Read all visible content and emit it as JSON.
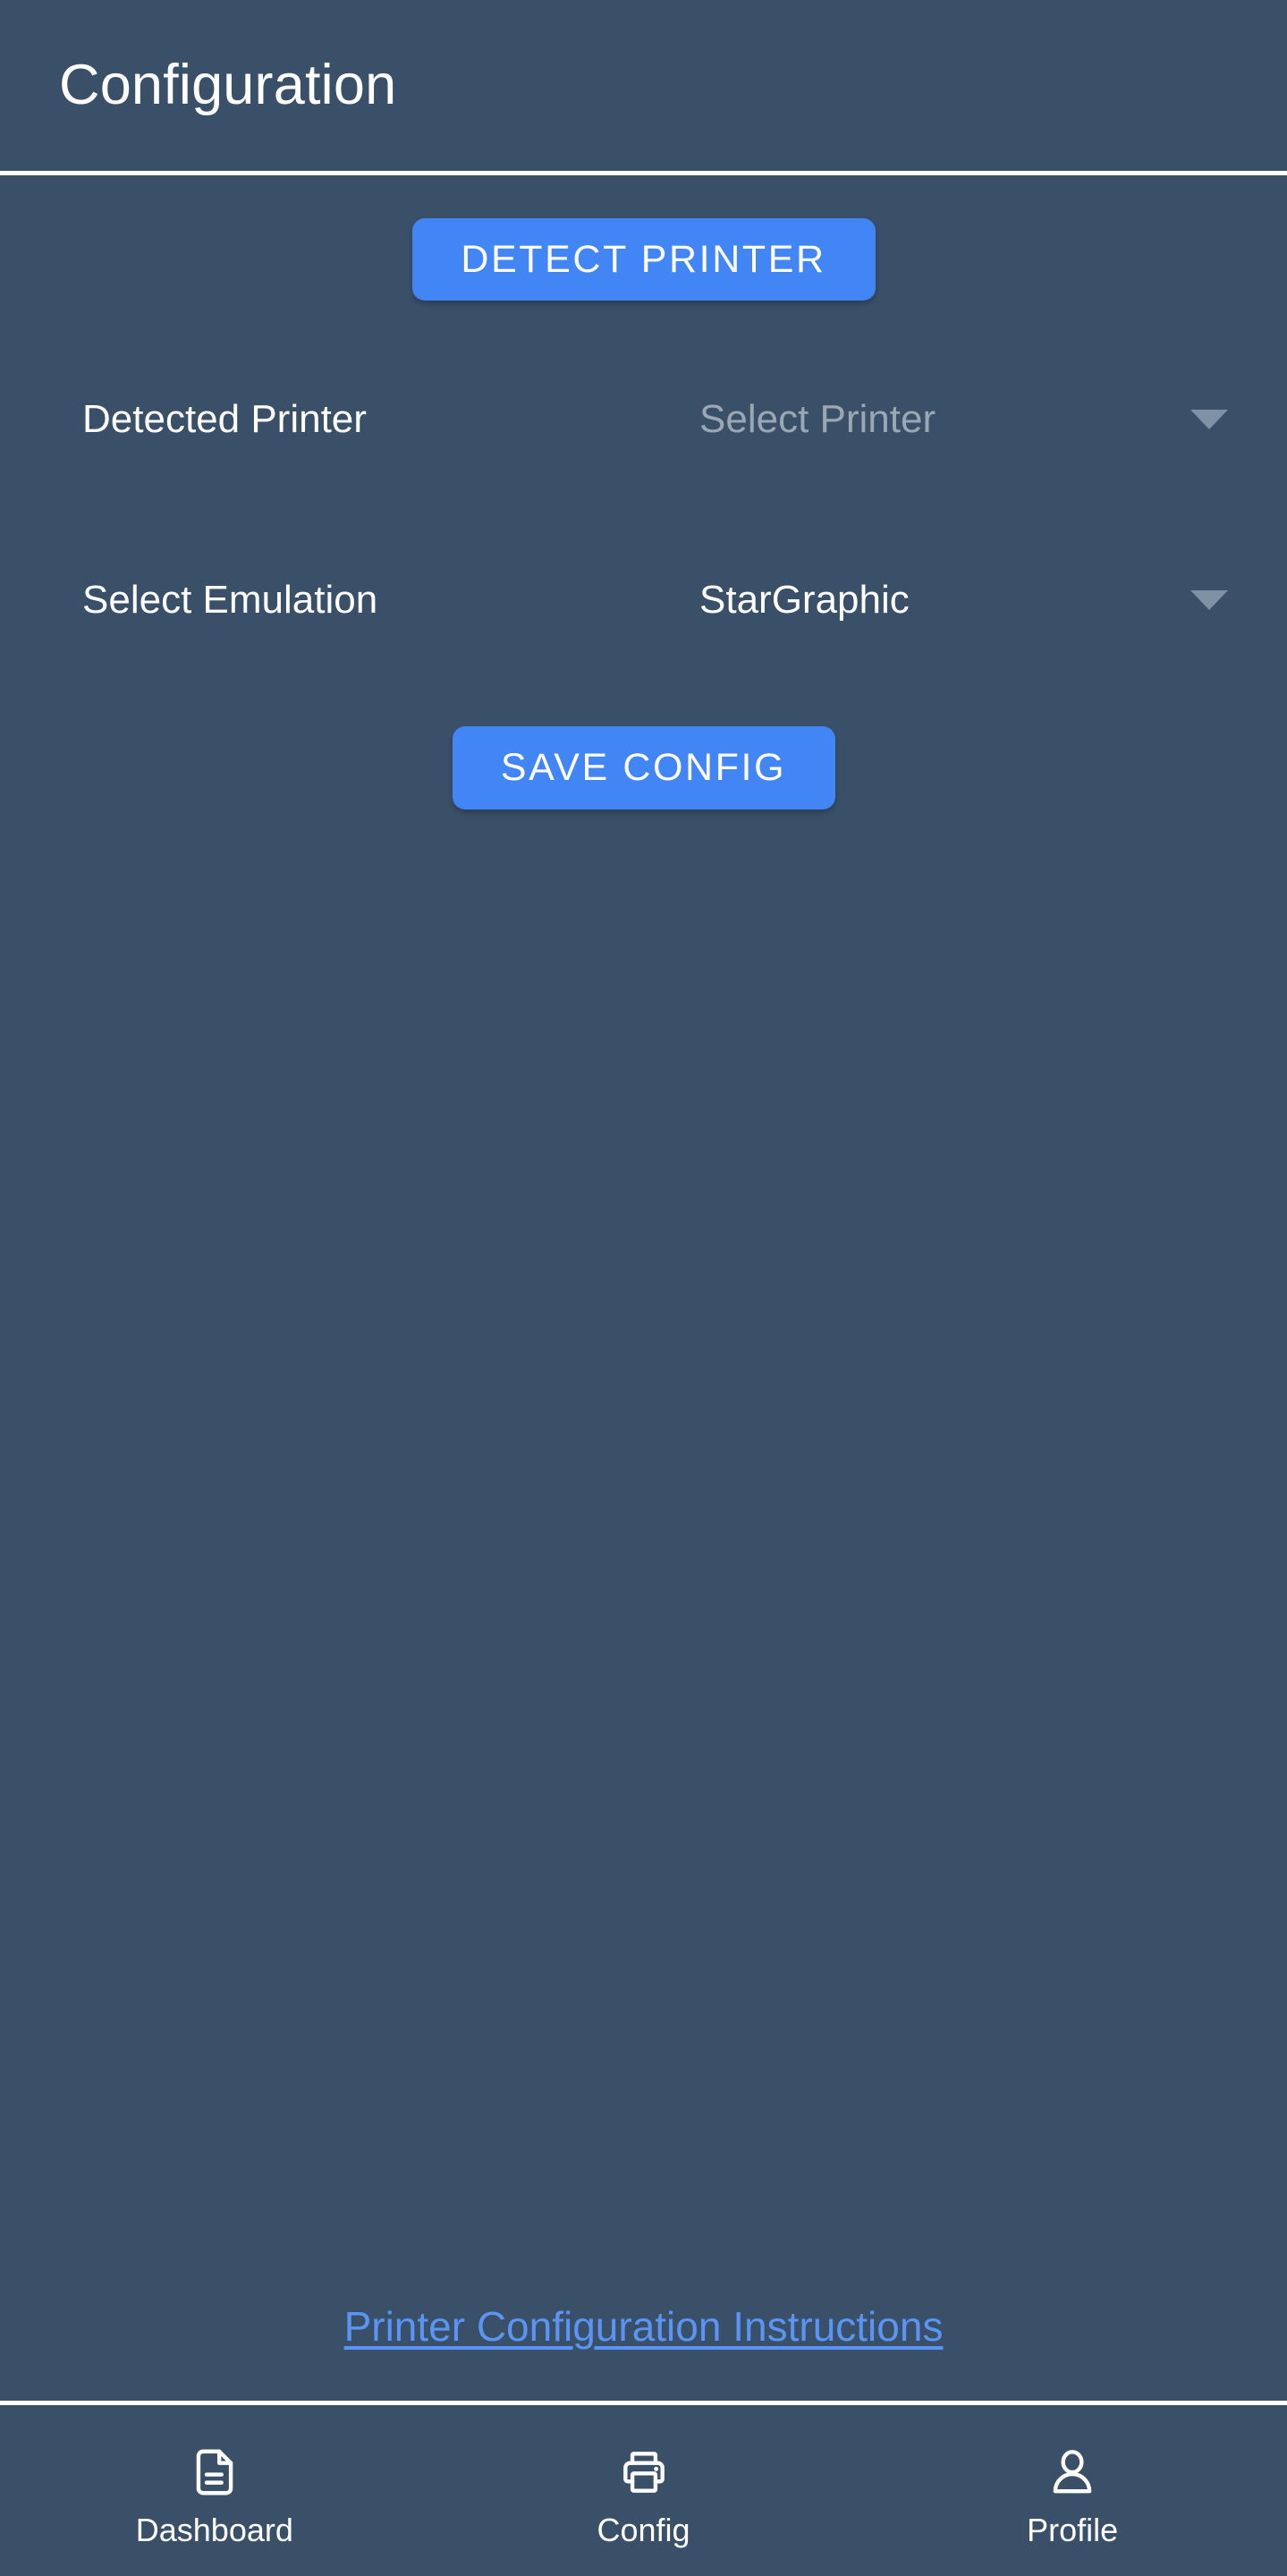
{
  "header": {
    "title": "Configuration"
  },
  "main": {
    "detect_button_label": "DETECT PRINTER",
    "rows": [
      {
        "label": "Detected Printer",
        "value": "",
        "placeholder": "Select Printer",
        "caret_icon": "chevron-down-icon"
      },
      {
        "label": "Select Emulation",
        "value": "StarGraphic",
        "placeholder": "",
        "caret_icon": "chevron-down-icon"
      }
    ],
    "save_button_label": "SAVE CONFIG",
    "instructions_link_label": "Printer Configuration Instructions"
  },
  "bottom_nav": {
    "items": [
      {
        "label": "Dashboard",
        "icon": "document-icon"
      },
      {
        "label": "Config",
        "icon": "printer-icon"
      },
      {
        "label": "Profile",
        "icon": "person-icon"
      }
    ]
  },
  "colors": {
    "background": "#3a5068",
    "accent_button": "#4285f4",
    "link": "#5a94f5",
    "text_primary": "#ffffff",
    "text_placeholder": "#9aa7b5",
    "caret": "#7e91a5",
    "divider": "#ffffff"
  }
}
